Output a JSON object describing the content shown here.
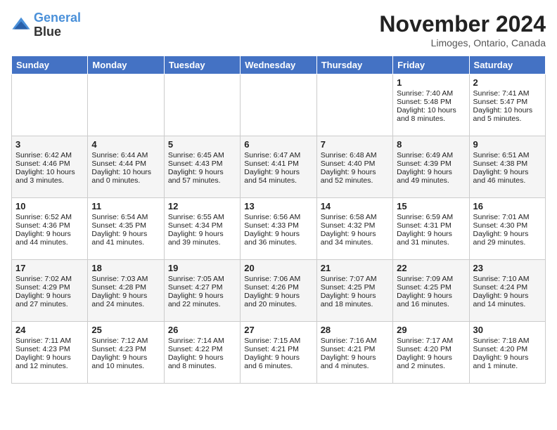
{
  "logo": {
    "line1": "General",
    "line2": "Blue"
  },
  "title": "November 2024",
  "location": "Limoges, Ontario, Canada",
  "days_of_week": [
    "Sunday",
    "Monday",
    "Tuesday",
    "Wednesday",
    "Thursday",
    "Friday",
    "Saturday"
  ],
  "weeks": [
    [
      {
        "day": "",
        "info": ""
      },
      {
        "day": "",
        "info": ""
      },
      {
        "day": "",
        "info": ""
      },
      {
        "day": "",
        "info": ""
      },
      {
        "day": "",
        "info": ""
      },
      {
        "day": "1",
        "info": "Sunrise: 7:40 AM\nSunset: 5:48 PM\nDaylight: 10 hours and 8 minutes."
      },
      {
        "day": "2",
        "info": "Sunrise: 7:41 AM\nSunset: 5:47 PM\nDaylight: 10 hours and 5 minutes."
      }
    ],
    [
      {
        "day": "3",
        "info": "Sunrise: 6:42 AM\nSunset: 4:46 PM\nDaylight: 10 hours and 3 minutes."
      },
      {
        "day": "4",
        "info": "Sunrise: 6:44 AM\nSunset: 4:44 PM\nDaylight: 10 hours and 0 minutes."
      },
      {
        "day": "5",
        "info": "Sunrise: 6:45 AM\nSunset: 4:43 PM\nDaylight: 9 hours and 57 minutes."
      },
      {
        "day": "6",
        "info": "Sunrise: 6:47 AM\nSunset: 4:41 PM\nDaylight: 9 hours and 54 minutes."
      },
      {
        "day": "7",
        "info": "Sunrise: 6:48 AM\nSunset: 4:40 PM\nDaylight: 9 hours and 52 minutes."
      },
      {
        "day": "8",
        "info": "Sunrise: 6:49 AM\nSunset: 4:39 PM\nDaylight: 9 hours and 49 minutes."
      },
      {
        "day": "9",
        "info": "Sunrise: 6:51 AM\nSunset: 4:38 PM\nDaylight: 9 hours and 46 minutes."
      }
    ],
    [
      {
        "day": "10",
        "info": "Sunrise: 6:52 AM\nSunset: 4:36 PM\nDaylight: 9 hours and 44 minutes."
      },
      {
        "day": "11",
        "info": "Sunrise: 6:54 AM\nSunset: 4:35 PM\nDaylight: 9 hours and 41 minutes."
      },
      {
        "day": "12",
        "info": "Sunrise: 6:55 AM\nSunset: 4:34 PM\nDaylight: 9 hours and 39 minutes."
      },
      {
        "day": "13",
        "info": "Sunrise: 6:56 AM\nSunset: 4:33 PM\nDaylight: 9 hours and 36 minutes."
      },
      {
        "day": "14",
        "info": "Sunrise: 6:58 AM\nSunset: 4:32 PM\nDaylight: 9 hours and 34 minutes."
      },
      {
        "day": "15",
        "info": "Sunrise: 6:59 AM\nSunset: 4:31 PM\nDaylight: 9 hours and 31 minutes."
      },
      {
        "day": "16",
        "info": "Sunrise: 7:01 AM\nSunset: 4:30 PM\nDaylight: 9 hours and 29 minutes."
      }
    ],
    [
      {
        "day": "17",
        "info": "Sunrise: 7:02 AM\nSunset: 4:29 PM\nDaylight: 9 hours and 27 minutes."
      },
      {
        "day": "18",
        "info": "Sunrise: 7:03 AM\nSunset: 4:28 PM\nDaylight: 9 hours and 24 minutes."
      },
      {
        "day": "19",
        "info": "Sunrise: 7:05 AM\nSunset: 4:27 PM\nDaylight: 9 hours and 22 minutes."
      },
      {
        "day": "20",
        "info": "Sunrise: 7:06 AM\nSunset: 4:26 PM\nDaylight: 9 hours and 20 minutes."
      },
      {
        "day": "21",
        "info": "Sunrise: 7:07 AM\nSunset: 4:25 PM\nDaylight: 9 hours and 18 minutes."
      },
      {
        "day": "22",
        "info": "Sunrise: 7:09 AM\nSunset: 4:25 PM\nDaylight: 9 hours and 16 minutes."
      },
      {
        "day": "23",
        "info": "Sunrise: 7:10 AM\nSunset: 4:24 PM\nDaylight: 9 hours and 14 minutes."
      }
    ],
    [
      {
        "day": "24",
        "info": "Sunrise: 7:11 AM\nSunset: 4:23 PM\nDaylight: 9 hours and 12 minutes."
      },
      {
        "day": "25",
        "info": "Sunrise: 7:12 AM\nSunset: 4:23 PM\nDaylight: 9 hours and 10 minutes."
      },
      {
        "day": "26",
        "info": "Sunrise: 7:14 AM\nSunset: 4:22 PM\nDaylight: 9 hours and 8 minutes."
      },
      {
        "day": "27",
        "info": "Sunrise: 7:15 AM\nSunset: 4:21 PM\nDaylight: 9 hours and 6 minutes."
      },
      {
        "day": "28",
        "info": "Sunrise: 7:16 AM\nSunset: 4:21 PM\nDaylight: 9 hours and 4 minutes."
      },
      {
        "day": "29",
        "info": "Sunrise: 7:17 AM\nSunset: 4:20 PM\nDaylight: 9 hours and 2 minutes."
      },
      {
        "day": "30",
        "info": "Sunrise: 7:18 AM\nSunset: 4:20 PM\nDaylight: 9 hours and 1 minute."
      }
    ]
  ]
}
